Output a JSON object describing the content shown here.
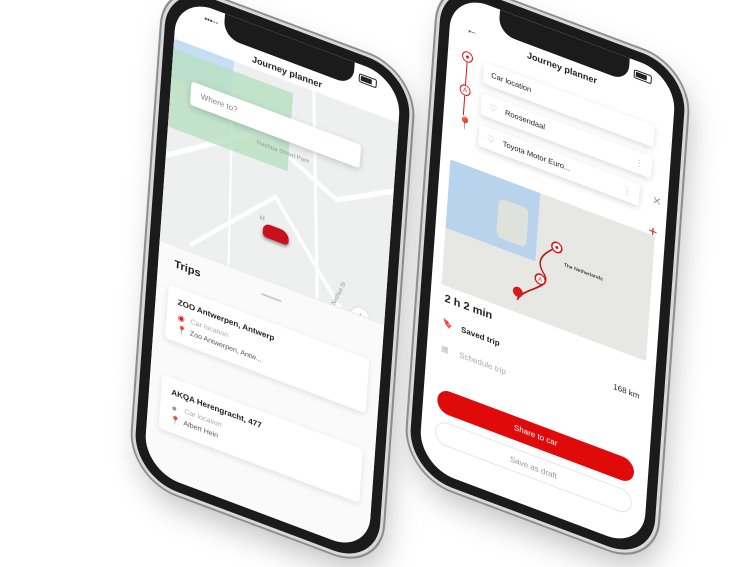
{
  "phone1": {
    "title": "Journey planner",
    "search": {
      "placeholder": "Where to?"
    },
    "map_labels": {
      "park": "Nashua Street Park",
      "street": "Nashua St",
      "m": "M"
    },
    "sheet": {
      "heading": "Trips",
      "cards": [
        {
          "title": "ZOO Antwerpen, Antwerp",
          "from": "Car location",
          "to": "Zoo Antwerpen, Antw..."
        },
        {
          "title": "AKQA Herengracht, 477",
          "from": "Car location",
          "to": "Albert Hein"
        }
      ]
    }
  },
  "phone2": {
    "title": "Journey planner",
    "stops": [
      {
        "label": "Car location"
      },
      {
        "label": "Roosendaal"
      },
      {
        "label": "Toyota Motor Euro..."
      }
    ],
    "map": {
      "label": "The Netherlands"
    },
    "duration": "2 h 2 min",
    "saved_trip": {
      "label": "Saved trip",
      "distance": "168 km"
    },
    "schedule_trip": {
      "label": "Schedule trip"
    },
    "share_button": "Share to car",
    "draft_button": "Save as draft"
  },
  "colors": {
    "accent": "#e10a0a",
    "park": "#b6dfc0",
    "sea": "#b9d3ec"
  },
  "icons": [
    "back-arrow-icon",
    "heart-icon",
    "kebab-icon",
    "close-icon",
    "plus-icon",
    "bookmark-icon",
    "calendar-icon",
    "locate-icon",
    "pin-icon"
  ]
}
